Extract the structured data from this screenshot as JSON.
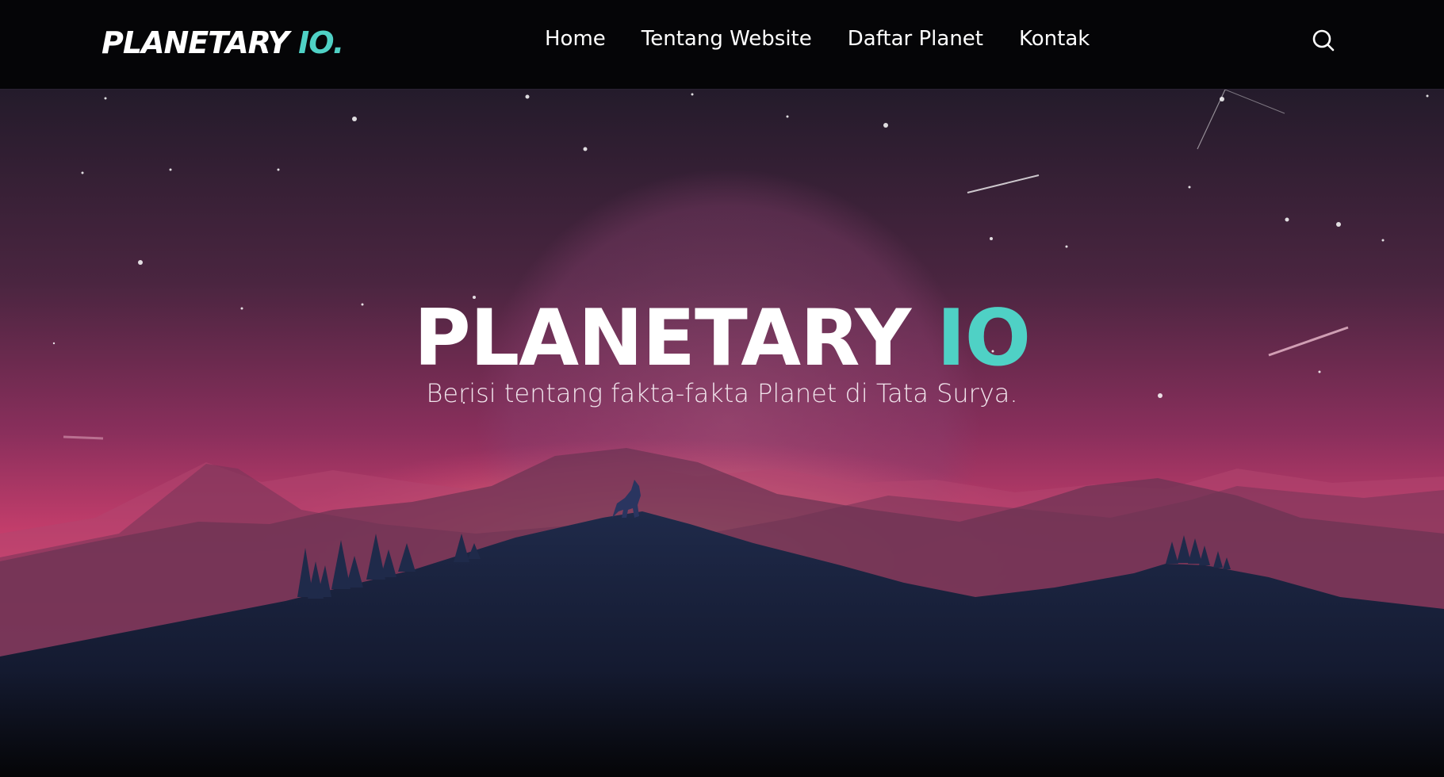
{
  "brand": {
    "name": "PLANETARY",
    "accent": "IO.",
    "accent_color": "#4fd1c5"
  },
  "nav": {
    "items": [
      {
        "label": "Home"
      },
      {
        "label": "Tentang Website"
      },
      {
        "label": "Daftar Planet"
      },
      {
        "label": "Kontak"
      }
    ],
    "search_icon": "search-icon"
  },
  "hero": {
    "title": "PLANETARY",
    "title_accent": "IO",
    "subtitle": "Berisi tentang fakta-fakta Planet di Tata Surya.",
    "colors": {
      "sky_top": "#231a2a",
      "sky_mid": "#8a2f5c",
      "sky_bottom": "#e0457c",
      "glow": "#f7b58a",
      "hills": "#1e2947"
    }
  }
}
